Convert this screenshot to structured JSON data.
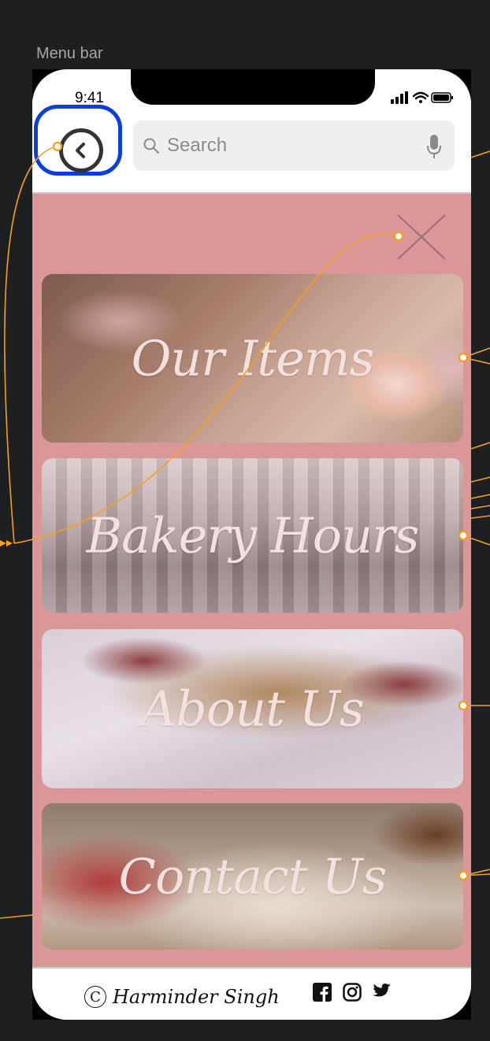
{
  "frame": {
    "label": "Menu bar"
  },
  "status_bar": {
    "time": "9:41"
  },
  "header": {
    "search": {
      "placeholder": "Search"
    }
  },
  "menu": {
    "items": [
      {
        "label": "Our Items"
      },
      {
        "label": "Bakery Hours"
      },
      {
        "label": "About Us"
      },
      {
        "label": "Contact Us"
      }
    ]
  },
  "footer": {
    "copyright_symbol": "C",
    "author": "Harminder Singh",
    "social": [
      "facebook-icon",
      "instagram-icon",
      "twitter-icon"
    ]
  },
  "colors": {
    "screen_bg": "#db9797",
    "highlight": "#0b3fd6",
    "connector": "#f3a021",
    "canvas": "#1e1f21"
  }
}
